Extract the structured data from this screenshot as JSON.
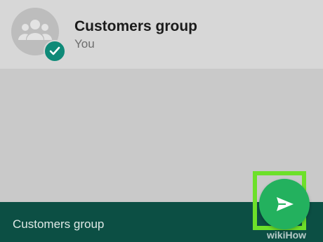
{
  "contact": {
    "name": "Customers group",
    "subtitle": "You",
    "avatar_icon": "group-icon",
    "selected_icon": "check-icon"
  },
  "footer": {
    "selected_label": "Customers group",
    "send_icon": "send-icon"
  },
  "watermark": "wikiHow",
  "colors": {
    "header_bg": "#d7d7d7",
    "body_bg": "#c9c9c9",
    "footer_bg": "#0c4f44",
    "send_button": "#23b15e",
    "check_badge": "#0f8a78",
    "highlight": "#6de02a"
  }
}
